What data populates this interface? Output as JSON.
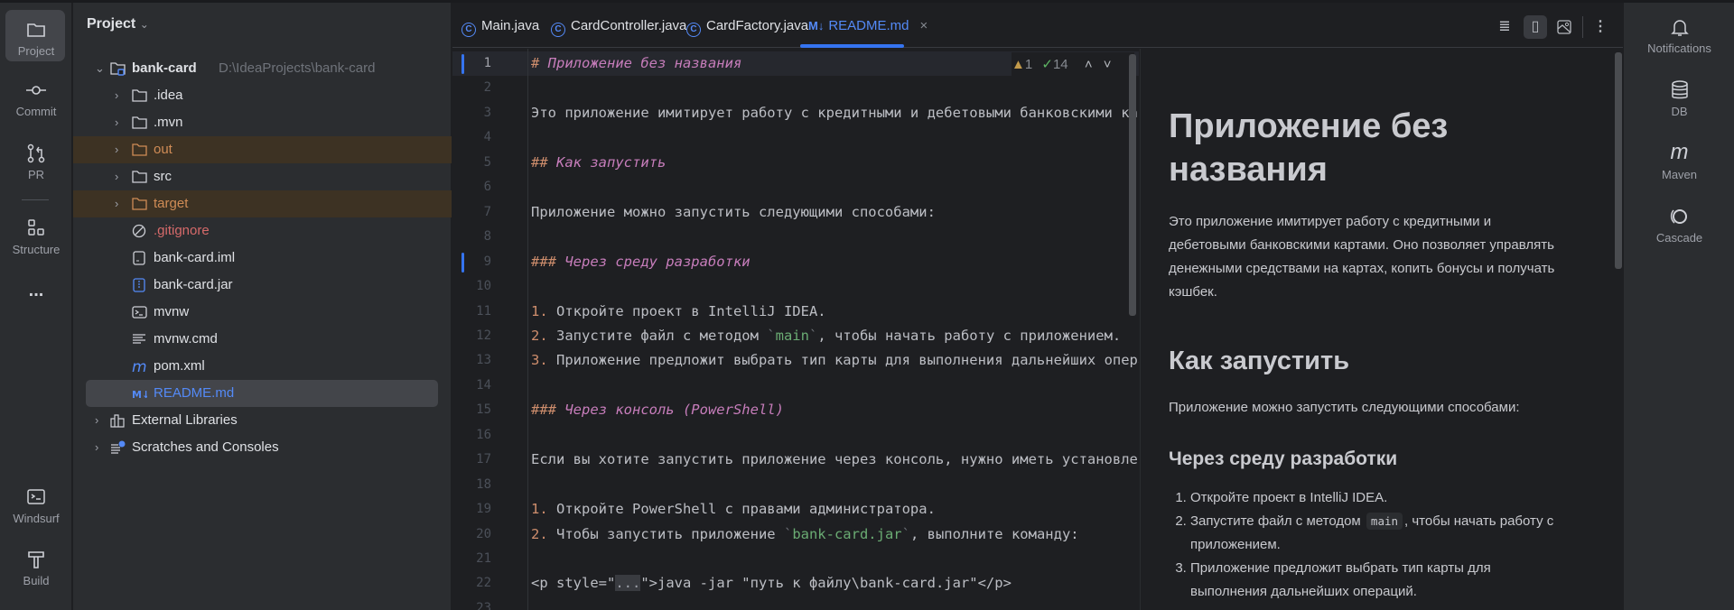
{
  "left_toolbar": {
    "items": [
      {
        "label": "Project",
        "icon": "folder-icon"
      },
      {
        "label": "Commit",
        "icon": "commit-icon"
      },
      {
        "label": "PR",
        "icon": "pull-request-icon"
      },
      {
        "label": "Structure",
        "icon": "structure-icon"
      },
      {
        "label": "Windsurf",
        "icon": "terminal-icon"
      },
      {
        "label": "Build",
        "icon": "hammer-icon"
      }
    ],
    "more": "..."
  },
  "right_toolbar": {
    "items": [
      {
        "label": "Notifications",
        "icon": "bell-icon"
      },
      {
        "label": "DB",
        "icon": "database-icon"
      },
      {
        "label": "Maven",
        "icon": "maven-icon"
      },
      {
        "label": "Cascade",
        "icon": "cascade-icon"
      }
    ]
  },
  "project": {
    "title": "Project",
    "root": {
      "name": "bank-card",
      "path": "D:\\IdeaProjects\\bank-card"
    },
    "items": [
      {
        "name": ".idea",
        "type": "folder"
      },
      {
        "name": ".mvn",
        "type": "folder"
      },
      {
        "name": "out",
        "type": "folder-excluded"
      },
      {
        "name": "src",
        "type": "folder"
      },
      {
        "name": "target",
        "type": "folder-excluded"
      },
      {
        "name": ".gitignore",
        "type": "ignore"
      },
      {
        "name": "bank-card.iml",
        "type": "iml"
      },
      {
        "name": "bank-card.jar",
        "type": "jar"
      },
      {
        "name": "mvnw",
        "type": "shell"
      },
      {
        "name": "mvnw.cmd",
        "type": "text"
      },
      {
        "name": "pom.xml",
        "type": "maven"
      },
      {
        "name": "README.md",
        "type": "markdown"
      }
    ],
    "external": "External Libraries",
    "scratches": "Scratches and Consoles"
  },
  "tabs": [
    {
      "label": "Main.java"
    },
    {
      "label": "CardController.java"
    },
    {
      "label": "CardFactory.java"
    },
    {
      "label": "README.md",
      "active": true,
      "icon_text": "M↓"
    }
  ],
  "inspection": {
    "warnings": "1",
    "typos": "14"
  },
  "colors": {
    "accent": "#548af7",
    "heading": "#c77dbb",
    "hash": "#cf8e6d",
    "code": "#6aab73",
    "excluded_bg": "#3d3223"
  },
  "editor_lines": [
    [
      [
        "# ",
        "hash"
      ],
      [
        "Приложение без названия",
        "h"
      ]
    ],
    [],
    [
      [
        "Это приложение имитирует работу с кредитными и дебетовыми банковскими картами.",
        ""
      ]
    ],
    [],
    [
      [
        "## ",
        "hash"
      ],
      [
        "Как запустить",
        "h"
      ]
    ],
    [],
    [
      [
        "Приложение можно запустить следующими способами:",
        ""
      ]
    ],
    [],
    [
      [
        "### ",
        "hash"
      ],
      [
        "Через среду разработки",
        "h"
      ]
    ],
    [],
    [
      [
        "1. ",
        "num"
      ],
      [
        "Откройте проект в IntelliJ IDEA.",
        ""
      ]
    ],
    [
      [
        "2. ",
        "num"
      ],
      [
        "Запустите файл с методом ",
        ""
      ],
      [
        "`",
        "bt"
      ],
      [
        "main",
        "code"
      ],
      [
        "`",
        "bt"
      ],
      [
        ", чтобы начать работу с приложением.",
        ""
      ]
    ],
    [
      [
        "3. ",
        "num"
      ],
      [
        "Приложение предложит выбрать тип карты для выполнения дальнейших операций.",
        ""
      ]
    ],
    [],
    [
      [
        "### ",
        "hash"
      ],
      [
        "Через консоль (PowerShell)",
        "h"
      ]
    ],
    [],
    [
      [
        "Если вы хотите запустить приложение через консоль, нужно иметь установленную Java.",
        ""
      ]
    ],
    [],
    [
      [
        "1. ",
        "num"
      ],
      [
        "Откройте PowerShell с правами администратора.",
        ""
      ]
    ],
    [
      [
        "2. ",
        "num"
      ],
      [
        "Чтобы запустить приложение ",
        ""
      ],
      [
        "`",
        "bt"
      ],
      [
        "bank-card.jar",
        "code"
      ],
      [
        "`",
        "bt"
      ],
      [
        ", выполните команду:",
        ""
      ]
    ],
    [],
    [
      [
        "<p style=\"",
        ""
      ],
      [
        "...",
        "fold"
      ],
      [
        "\">java -jar \"путь к файлу\\bank-card.jar\"</p>",
        ""
      ]
    ],
    []
  ],
  "preview": {
    "h1": "Приложение без названия",
    "intro": "Это приложение имитирует работу с кредитными и дебетовыми банковскими картами. Оно позволяет управлять денежными средствами на картах, копить бонусы и получать кэшбек.",
    "h2": "Как запустить",
    "p2": "Приложение можно запустить следующими способами:",
    "h3": "Через среду разработки",
    "li1": "Откройте проект в IntelliJ IDEA.",
    "li2_pre": "Запустите файл с методом",
    "li2_code": "main",
    "li2_post": ", чтобы начать работу с приложением.",
    "li3": "Приложение предложит выбрать тип карты для выполнения дальнейших операций."
  }
}
